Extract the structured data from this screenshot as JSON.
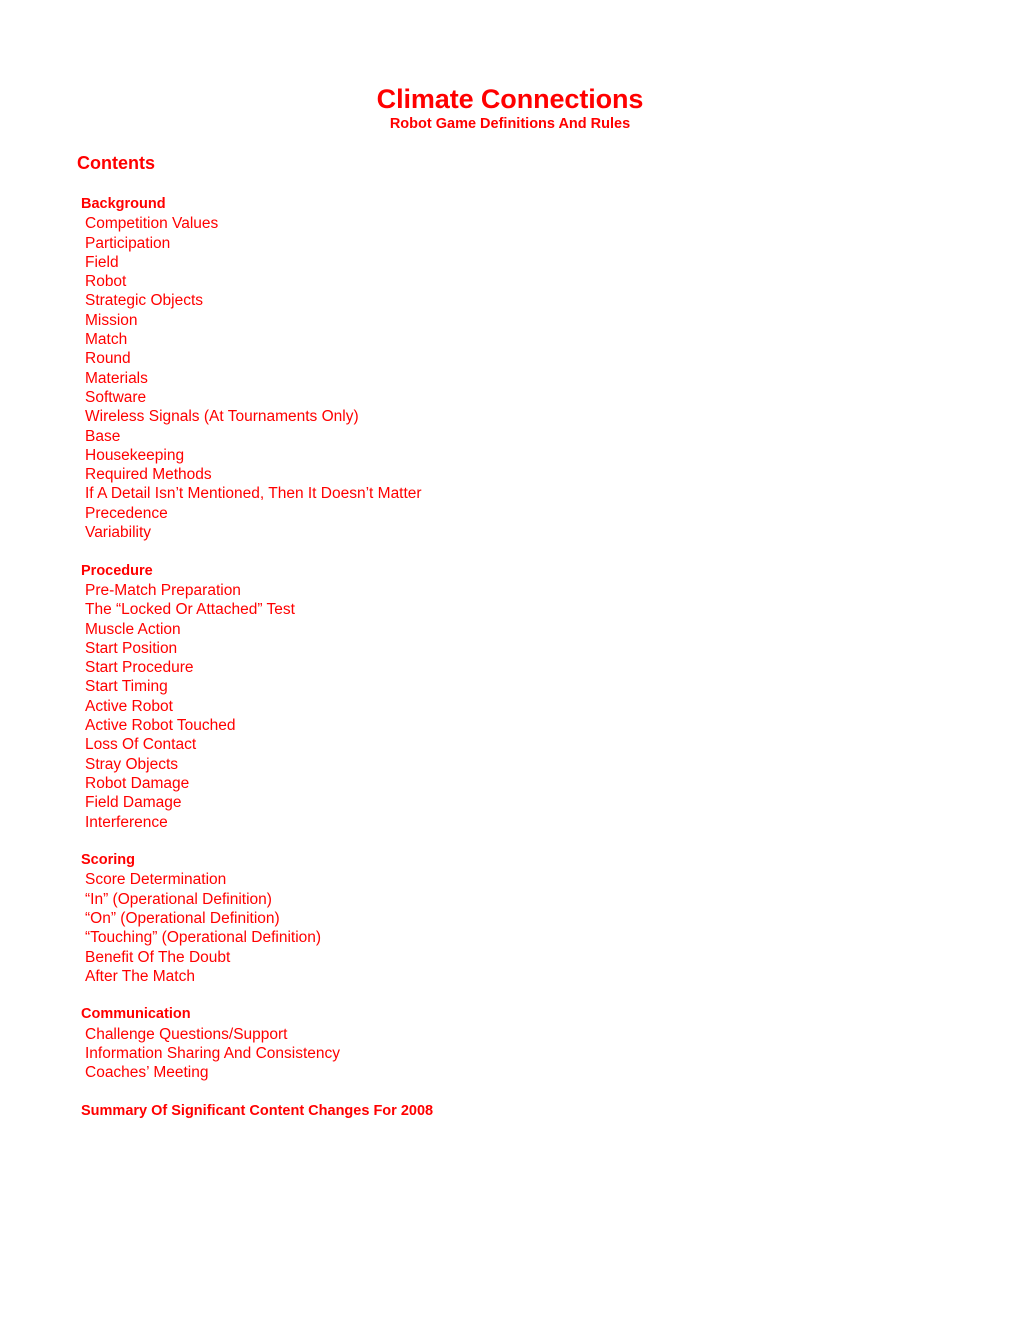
{
  "document": {
    "title": "Climate Connections",
    "subtitle": "Robot Game Definitions And Rules",
    "contents_heading": "Contents",
    "text_color": "#ff0000",
    "background_color": "#ffffff"
  },
  "toc": {
    "sections": [
      {
        "title": "Background",
        "items": [
          "Competition Values",
          "Participation",
          "Field",
          "Robot",
          "Strategic Objects",
          "Mission",
          "Match",
          "Round",
          "Materials",
          "Software",
          "Wireless Signals (At Tournaments Only)",
          "Base",
          "Housekeeping",
          "Required Methods",
          "If A Detail Isn’t Mentioned, Then It Doesn’t Matter",
          "Precedence",
          "Variability"
        ]
      },
      {
        "title": "Procedure",
        "items": [
          "Pre-Match Preparation",
          "The “Locked Or Attached” Test",
          "Muscle Action",
          "Start Position",
          "Start Procedure",
          "Start Timing",
          "Active Robot",
          "Active Robot Touched",
          "Loss Of Contact",
          "Stray Objects",
          "Robot Damage",
          "Field Damage",
          "Interference"
        ]
      },
      {
        "title": "Scoring",
        "items": [
          "Score Determination",
          "“In” (Operational Definition)",
          "“On” (Operational Definition)",
          "“Touching” (Operational Definition)",
          "Benefit Of The Doubt",
          "After The Match"
        ]
      },
      {
        "title": "Communication",
        "items": [
          "Challenge Questions/Support",
          "Information Sharing And Consistency",
          "Coaches’ Meeting"
        ]
      }
    ],
    "closing_heading": "Summary Of Significant Content Changes For 2008"
  }
}
